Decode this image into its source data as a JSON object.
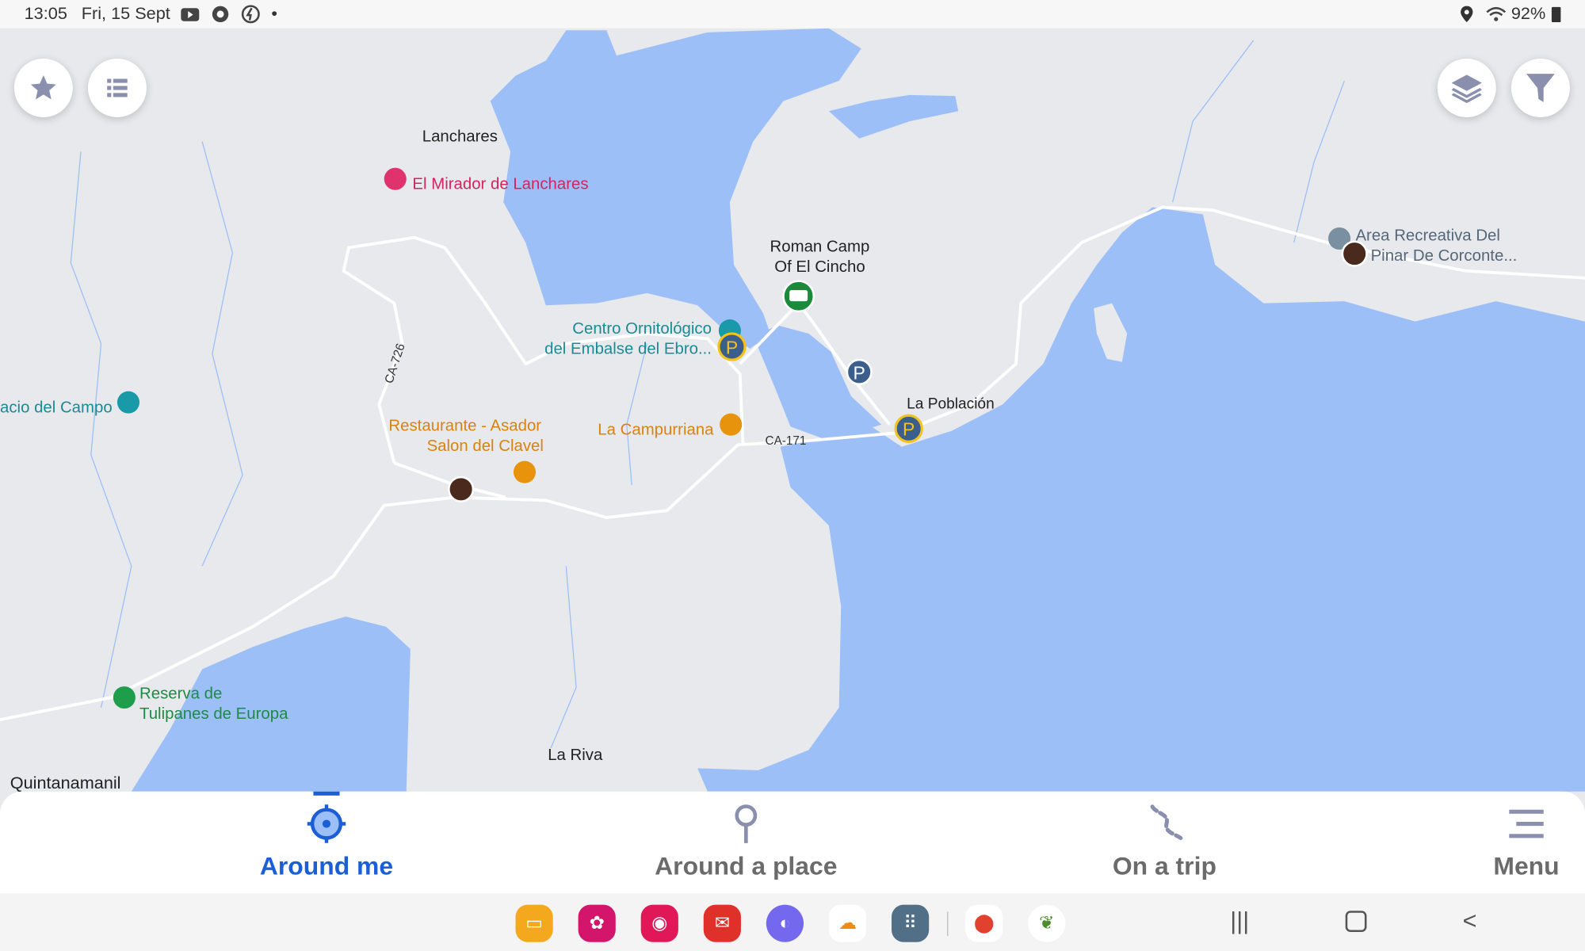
{
  "status_bar": {
    "time": "13:05",
    "date": "Fri, 15 Sept",
    "battery": "92%",
    "icons": [
      "youtube-icon",
      "chrome-icon",
      "vpn-icon",
      "dot-icon",
      "location-icon",
      "wifi-icon",
      "battery-icon"
    ]
  },
  "map": {
    "labels": {
      "lanchares": "Lanchares",
      "mirador": "El Mirador de Lanchares",
      "roman_camp_1": "Roman Camp",
      "roman_camp_2": "Of El Cincho",
      "centro_1": "Centro Ornitológico",
      "centro_2": "del Embalse del Ebro...",
      "area_1": "Area Recreativa Del",
      "area_2": "Pinar De Corconte...",
      "palacio": "acio del Campo",
      "restaurante_1": "Restaurante - Asador",
      "restaurante_2": "Salon del Clavel",
      "campurriana": "La Campurriana",
      "poblacion": "La Población",
      "ca171": "CA-171",
      "ca726": "CA-726",
      "reserva_1": "Reserva de",
      "reserva_2": "Tulipanes de Europa",
      "la_riva": "La Riva",
      "quintanamanil": "Quintanamanil",
      "parking": "P"
    },
    "colors": {
      "water": "#9cbff8",
      "land": "#e8e9ec",
      "road": "#ffffff",
      "hotel": "#e0336e",
      "food": "#e8930c",
      "nature": "#1e9e4a",
      "camp": "#1b8a3a",
      "parking": "#3b5e8c",
      "tourism": "#1a9aa8"
    }
  },
  "controls": {
    "favorites": "star-icon",
    "list": "list-icon",
    "layers": "layers-icon",
    "filter": "filter-icon"
  },
  "bottom_nav": {
    "items": [
      {
        "label": "Around me",
        "icon": "crosshair-icon",
        "active": true
      },
      {
        "label": "Around a place",
        "icon": "pin-icon",
        "active": false
      },
      {
        "label": "On a trip",
        "icon": "route-icon",
        "active": false
      },
      {
        "label": "Menu",
        "icon": "menu-icon",
        "active": false
      }
    ]
  },
  "dock": {
    "apps": [
      "files",
      "blossom",
      "camera",
      "email",
      "internet",
      "cloud",
      "apps-grid",
      "maps",
      "app-leaf"
    ],
    "nav": [
      "recents",
      "home",
      "back"
    ]
  }
}
